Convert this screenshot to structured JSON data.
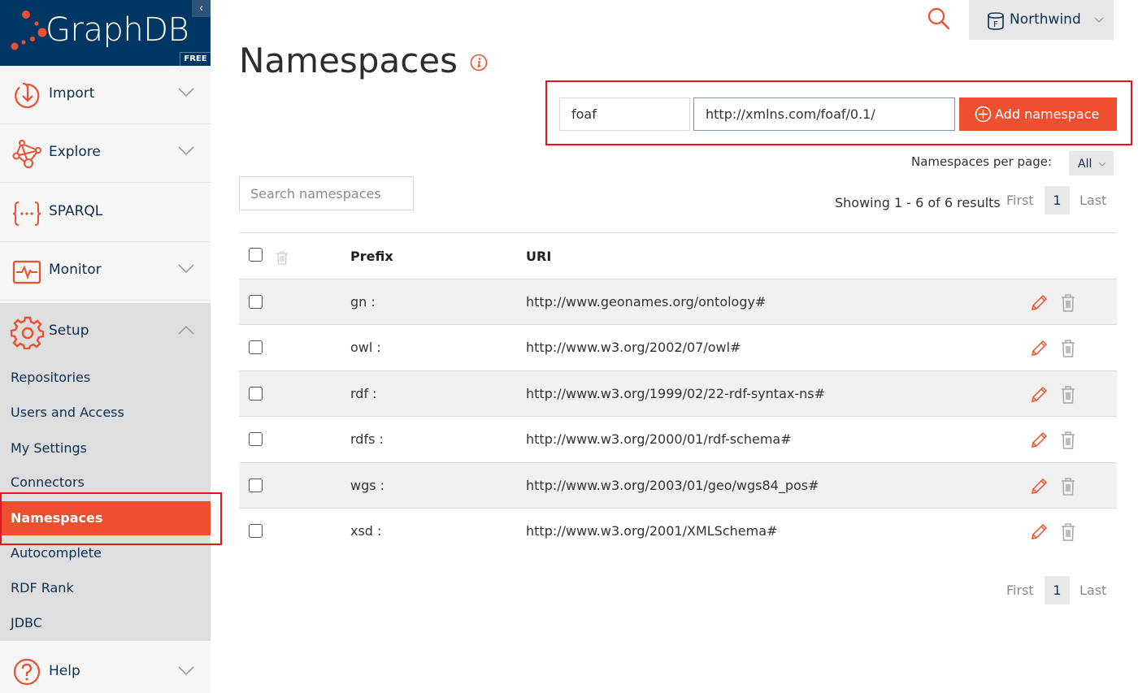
{
  "brand": {
    "name": "GraphDB",
    "edition_badge": "FREE",
    "collapse_glyph": "‹"
  },
  "sidebar": {
    "items": [
      {
        "label": "Import",
        "icon": "import-icon",
        "expandable": true
      },
      {
        "label": "Explore",
        "icon": "explore-icon",
        "expandable": true
      },
      {
        "label": "SPARQL",
        "icon": "sparql-icon",
        "expandable": false
      },
      {
        "label": "Monitor",
        "icon": "monitor-icon",
        "expandable": true
      },
      {
        "label": "Setup",
        "icon": "gear-icon",
        "expandable": true,
        "expanded": true
      },
      {
        "label": "Help",
        "icon": "help-icon",
        "expandable": true
      }
    ],
    "setup_subitems": [
      {
        "label": "Repositories"
      },
      {
        "label": "Users and Access"
      },
      {
        "label": "My Settings"
      },
      {
        "label": "Connectors"
      },
      {
        "label": "Namespaces",
        "active": true
      },
      {
        "label": "Autocomplete"
      },
      {
        "label": "RDF Rank"
      },
      {
        "label": "JDBC"
      }
    ]
  },
  "topbar": {
    "search_icon": "search-icon",
    "repository": {
      "name": "Northwind",
      "icon_letter": "F"
    }
  },
  "page": {
    "title": "Namespaces"
  },
  "add_form": {
    "prefix_value": "foaf",
    "uri_value": "http://xmlns.com/foaf/0.1/",
    "button_label": "Add namespace"
  },
  "search": {
    "placeholder": "Search namespaces",
    "value": ""
  },
  "pagination": {
    "per_page_label": "Namespaces per page:",
    "per_page_value": "All",
    "showing_text": "Showing 1 - 6 of 6 results",
    "first_label": "First",
    "current_page": "1",
    "last_label": "Last"
  },
  "table": {
    "columns": [
      "Prefix",
      "URI"
    ],
    "rows": [
      {
        "prefix": "gn :",
        "uri": "http://www.geonames.org/ontology#"
      },
      {
        "prefix": "owl :",
        "uri": "http://www.w3.org/2002/07/owl#"
      },
      {
        "prefix": "rdf :",
        "uri": "http://www.w3.org/1999/02/22-rdf-syntax-ns#"
      },
      {
        "prefix": "rdfs :",
        "uri": "http://www.w3.org/2000/01/rdf-schema#"
      },
      {
        "prefix": "wgs :",
        "uri": "http://www.w3.org/2003/01/geo/wgs84_pos#"
      },
      {
        "prefix": "xsd :",
        "uri": "http://www.w3.org/2001/XMLSchema#"
      }
    ]
  },
  "colors": {
    "brand_navy": "#003663",
    "accent_orange": "#ed4f2f",
    "highlight_red": "#e3141b",
    "text_navy": "#0d2e52"
  }
}
